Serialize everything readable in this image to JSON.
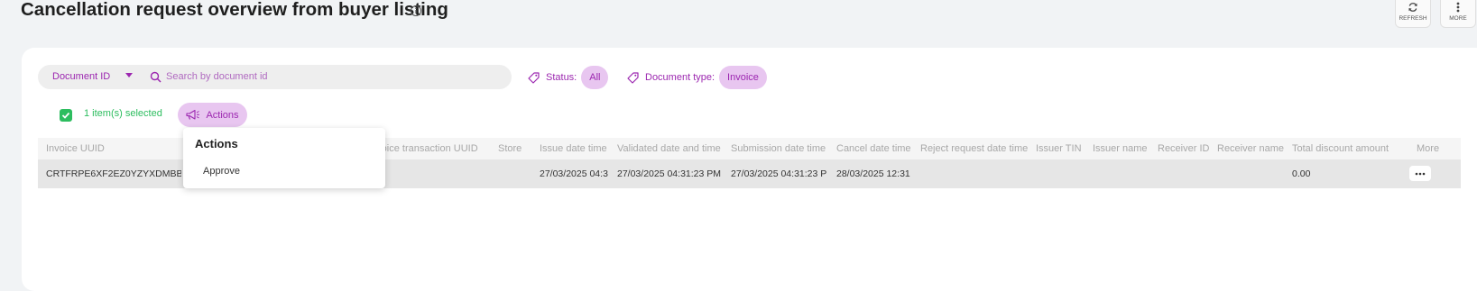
{
  "header": {
    "title": "Cancellation request overview from buyer listing",
    "refresh_label": "REFRESH",
    "more_label": "MORE"
  },
  "search": {
    "field_selector": "Document ID",
    "placeholder": "Search by document id",
    "value": ""
  },
  "filters": {
    "status_label": "Status:",
    "status_value": "All",
    "doc_type_label": "Document type:",
    "doc_type_value": "Invoice"
  },
  "selection": {
    "selected_text": "1 item(s) selected",
    "actions_label": "Actions",
    "checked": true
  },
  "dropdown": {
    "title": "Actions",
    "items": [
      "Approve"
    ]
  },
  "table": {
    "columns": [
      "Invoice UUID",
      "Invoice transaction UUID",
      "Store",
      "Issue date time",
      "Validated date and time",
      "Submission date time",
      "Cancel date time",
      "Reject request date time",
      "Issuer TIN",
      "Issuer name",
      "Receiver ID",
      "Receiver name",
      "Total discount amount",
      "More"
    ],
    "rows": [
      {
        "invoice_uuid": "CRTFRPE6XF2EZ0YZYXDMBB0",
        "invoice_transaction_uuid": "",
        "store": "",
        "issue_date_time": "27/03/2025 04:3",
        "validated_date_time": "27/03/2025 04:31:23 PM",
        "submission_date_time": "27/03/2025 04:31:23 P",
        "cancel_date_time": "28/03/2025 12:31",
        "reject_request_date_time": "",
        "issuer_tin": "",
        "issuer_name": "",
        "receiver_id": "",
        "receiver_name": "",
        "total_discount_amount": "0.00"
      }
    ]
  },
  "colors": {
    "accent": "#9c27b0",
    "chip_bg": "#e8c6f0",
    "success": "#2dbd5f"
  }
}
